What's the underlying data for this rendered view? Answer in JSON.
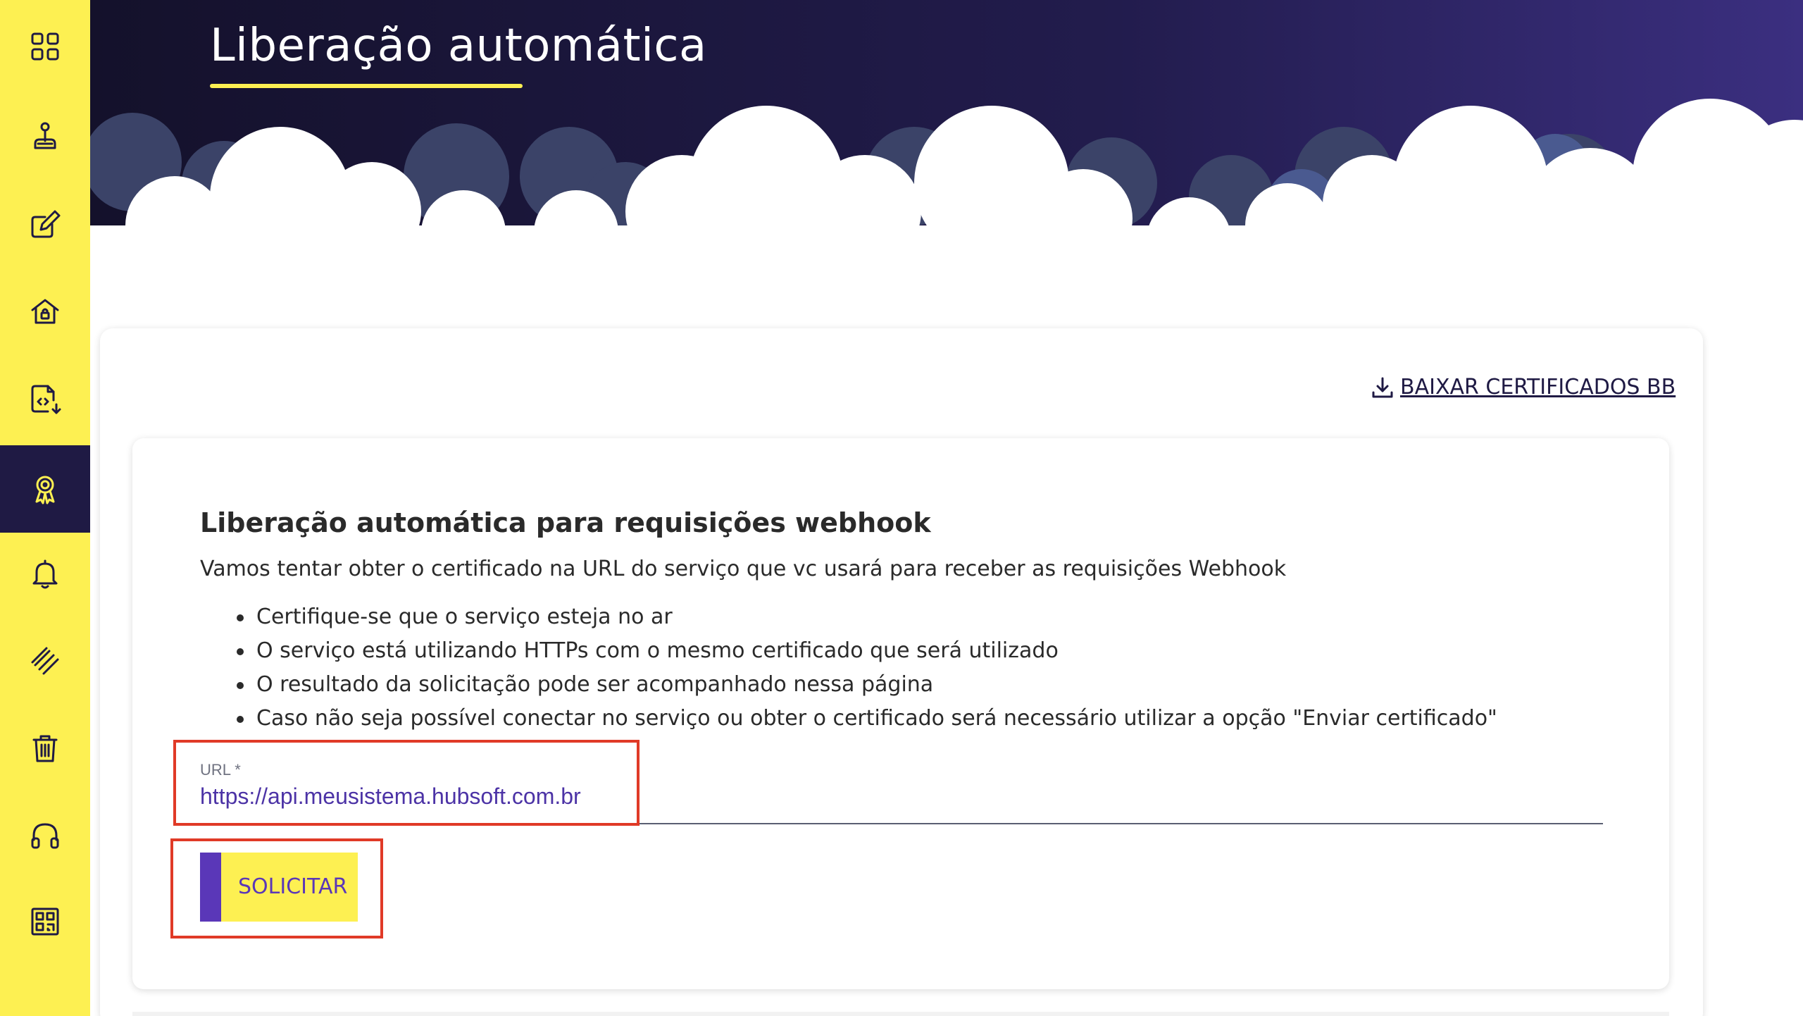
{
  "header": {
    "title": "Liberação automática"
  },
  "sidebar": {
    "items": [
      {
        "name": "grid-icon",
        "active": false
      },
      {
        "name": "joystick-icon",
        "active": false
      },
      {
        "name": "edit-icon",
        "active": false
      },
      {
        "name": "home-lock-icon",
        "active": false
      },
      {
        "name": "code-file-icon",
        "active": false
      },
      {
        "name": "certificate-icon",
        "active": true
      },
      {
        "name": "bell-icon",
        "active": false
      },
      {
        "name": "link-icon",
        "active": false
      },
      {
        "name": "trash-icon",
        "active": false
      },
      {
        "name": "headset-icon",
        "active": false
      },
      {
        "name": "qr-code-icon",
        "active": false
      }
    ]
  },
  "actions": {
    "download_label": "BAIXAR CERTIFICADOS BB"
  },
  "form": {
    "title": "Liberação automática para requisições webhook",
    "description": "Vamos tentar obter o certificado na URL do serviço que vc usará para receber as requisições Webhook",
    "bullets": [
      "Certifique-se que o serviço esteja no ar",
      "O serviço está utilizando HTTPs com o mesmo certificado que será utilizado",
      "O resultado da solicitação pode ser acompanhado nessa página",
      "Caso não seja possível conectar no serviço ou obter o certificado será necessário utilizar a opção \"Enviar certificado\""
    ],
    "url_label": "URL *",
    "url_value": "https://api.meusistema.hubsoft.com.br",
    "submit_label": "SOLICITAR"
  },
  "colors": {
    "sidebar": "#fdf052",
    "navy": "#1f1a44",
    "accent_purple": "#5a37b8",
    "highlight_red": "#e03a27"
  }
}
